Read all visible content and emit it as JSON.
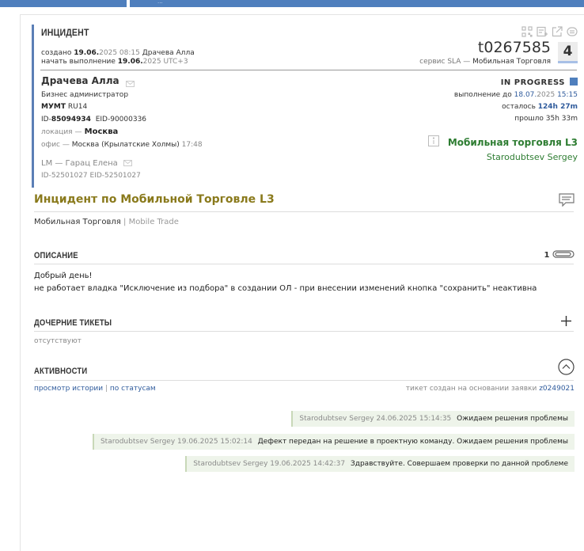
{
  "topbar": {
    "tab2_label": "..."
  },
  "incident": {
    "label": "ИНЦИДЕНТ",
    "created_prefix": "создано",
    "created_date_bold": "19.06.",
    "created_date_year": "2025",
    "created_time": "08:15",
    "created_by": "Драчева Алла",
    "started_prefix": "начать выполнение",
    "started_date_bold": "19.06.",
    "started_date_year": "2025",
    "started_tz": "UTC+3",
    "ticket_id": "t0267585",
    "sla_prefix": "сервис SLA —",
    "sla_service": "Мобильная Торговля",
    "priority": "4"
  },
  "person": {
    "name": "Драчева Алла",
    "role": "Бизнес администратор",
    "org_bold": "МУМТ",
    "org_code": "RU14",
    "id_prefix": "ID-",
    "id_value": "85094934",
    "eid_prefix": "EID-",
    "eid_value": "90000336",
    "location_prefix": "локация —",
    "location": "Москва",
    "office_prefix": "офис —",
    "office": "Москва (Крылатские Холмы)",
    "office_time": "17:48",
    "lm_label": "LM — Гарац Елена",
    "lm_ids": "ID-52501027  EID-52501027"
  },
  "status": {
    "label": "IN PROGRESS",
    "color": "#4f7fbd",
    "deadline_prefix": "выполнение до",
    "deadline_date": "18.07.",
    "deadline_year": "2025",
    "deadline_time": "15:15",
    "remaining_prefix": "осталось",
    "remaining": "124h 27m",
    "elapsed_prefix": "прошло",
    "elapsed": "35h 33m",
    "group": "Мобильная торговля L3",
    "assignee": "Starodubtsev Sergey"
  },
  "ticket": {
    "title": "Инцидент по Мобильной Торговле L3",
    "service_ru": "Мобильная Торговля",
    "service_sep": "|",
    "service_en": "Mobile Trade"
  },
  "description": {
    "title": "ОПИСАНИЕ",
    "attachments_count": "1",
    "line1": "Добрый день!",
    "line2": "не работает владка \"Исключение из подбора\" в создании ОЛ - при внесении изменений кнопка \"сохранить\" неактивна"
  },
  "children": {
    "title": "ДОЧЕРНИЕ ТИКЕТЫ",
    "empty": "отсутствуют"
  },
  "activity": {
    "title": "АКТИВНОСТИ",
    "history_link": "просмотр истории",
    "sep": "|",
    "status_link": "по статусам",
    "basis_prefix": "тикет создан на основании заявки",
    "basis_id": "z0249021",
    "entries": [
      {
        "who": "Starodubtsev Sergey 24.06.2025 15:14:35",
        "text": "Ожидаем решения проблемы"
      },
      {
        "who": "Starodubtsev Sergey 19.06.2025 15:02:14",
        "text": "Дефект передан на решение в проектную команду. Ожидаем решения проблемы"
      },
      {
        "who": "Starodubtsev Sergey 19.06.2025 14:42:37",
        "text": "Здравствуйте. Совершаем проверки по данной проблеме"
      }
    ]
  },
  "icons": [
    "qr-icon",
    "note-add-icon",
    "external-link-icon",
    "chat-icon",
    "mail-icon",
    "info-icon",
    "comment-icon",
    "paperclip-icon",
    "plus-icon",
    "chevron-up-circle-icon"
  ]
}
